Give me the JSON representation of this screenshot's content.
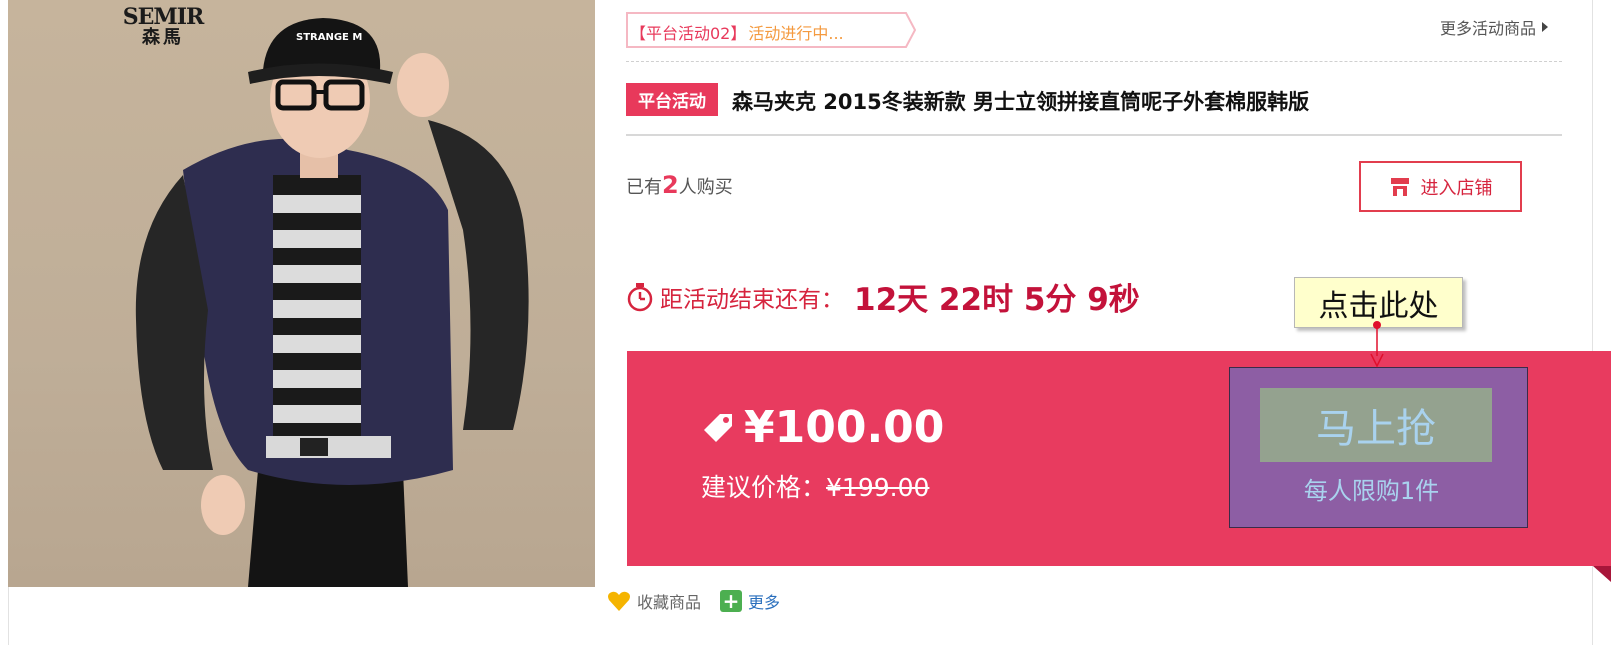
{
  "product_image": {
    "brand_en": "SEMIR",
    "brand_cn": "森馬",
    "hat_text": "STRANGE M"
  },
  "activity": {
    "tag": "【平台活动02】",
    "status": "活动进行中...",
    "more_link": "更多活动商品"
  },
  "product": {
    "badge": "平台活动",
    "title": "森马夹克 2015冬装新款 男士立领拼接直筒呢子外套棉服韩版"
  },
  "sales": {
    "prefix": "已有",
    "count": "2",
    "suffix": "人购买"
  },
  "store": {
    "enter_label": "进入店铺"
  },
  "countdown": {
    "label": "距活动结束还有：",
    "value": "12天 22时 5分 9秒"
  },
  "price": {
    "current": "¥100.00",
    "suggest_label": "建议价格：",
    "suggest_value": "¥199.00"
  },
  "buy": {
    "button_label": "马上抢",
    "limit_text": "每人限购1件"
  },
  "callout": {
    "text": "点击此处"
  },
  "footer": {
    "favorite_label": "收藏商品",
    "more_label": "更多"
  },
  "colors": {
    "accent": "#e8395b",
    "price_band": "#e83b5f",
    "buy_panel": "#8d5ea4",
    "buy_button": "#94a28f",
    "buy_text": "#a9d2ee",
    "callout_bg": "#ffffcc"
  }
}
